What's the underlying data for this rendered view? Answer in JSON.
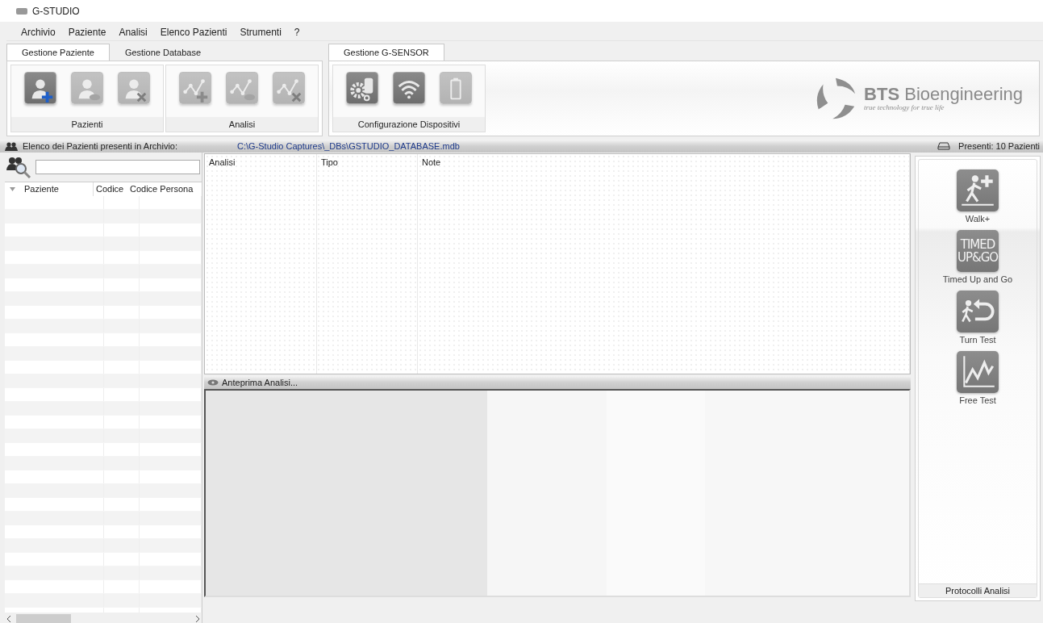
{
  "window": {
    "title": "G-STUDIO"
  },
  "menu": [
    "Archivio",
    "Paziente",
    "Analisi",
    "Elenco Pazienti",
    "Strumenti",
    "?"
  ],
  "ribbon_tabsets": [
    {
      "tabs": [
        {
          "label": "Gestione Paziente",
          "selected": true
        },
        {
          "label": "Gestione Database",
          "selected": false
        }
      ],
      "groups": [
        {
          "label": "Pazienti",
          "buttons": [
            {
              "kind": "patient-add",
              "disabled": false
            },
            {
              "kind": "patient-view",
              "disabled": true
            },
            {
              "kind": "patient-delete",
              "disabled": true
            }
          ]
        },
        {
          "label": "Analisi",
          "buttons": [
            {
              "kind": "analysis-add",
              "disabled": true
            },
            {
              "kind": "analysis-view",
              "disabled": true
            },
            {
              "kind": "analysis-delete",
              "disabled": true
            }
          ]
        }
      ]
    },
    {
      "tabs": [
        {
          "label": "Gestione G-SENSOR",
          "selected": true
        }
      ],
      "groups": [
        {
          "label": "Configurazione Dispositivi",
          "buttons": [
            {
              "kind": "device-settings",
              "disabled": false
            },
            {
              "kind": "wireless",
              "disabled": false
            },
            {
              "kind": "battery",
              "disabled": true
            }
          ]
        }
      ],
      "logo": {
        "name": "**BTS** Bioengineering",
        "tagline": "true technology for true life"
      }
    }
  ],
  "archive_bar": {
    "label": "Elenco dei Pazienti presenti in Archivio:",
    "path": "C:\\G-Studio Captures\\_DBs\\GSTUDIO_DATABASE.mdb",
    "count": "Presenti: 10 Pazienti"
  },
  "patients_table": {
    "columns": [
      "Paziente",
      "Codice",
      "Codice Persona"
    ]
  },
  "analyses_table": {
    "columns": [
      "Analisi",
      "Tipo",
      "Note"
    ]
  },
  "preview": {
    "title": "Anteprima Analisi..."
  },
  "protocols": {
    "items": [
      {
        "kind": "walk",
        "label": "Walk+"
      },
      {
        "kind": "text",
        "icon_text": [
          "TIMED",
          "UP&GO"
        ],
        "label": "Timed Up and Go"
      },
      {
        "kind": "turn",
        "label": "Turn Test"
      },
      {
        "kind": "free",
        "label": "Free Test"
      }
    ],
    "footer": "Protocolli Analisi"
  }
}
